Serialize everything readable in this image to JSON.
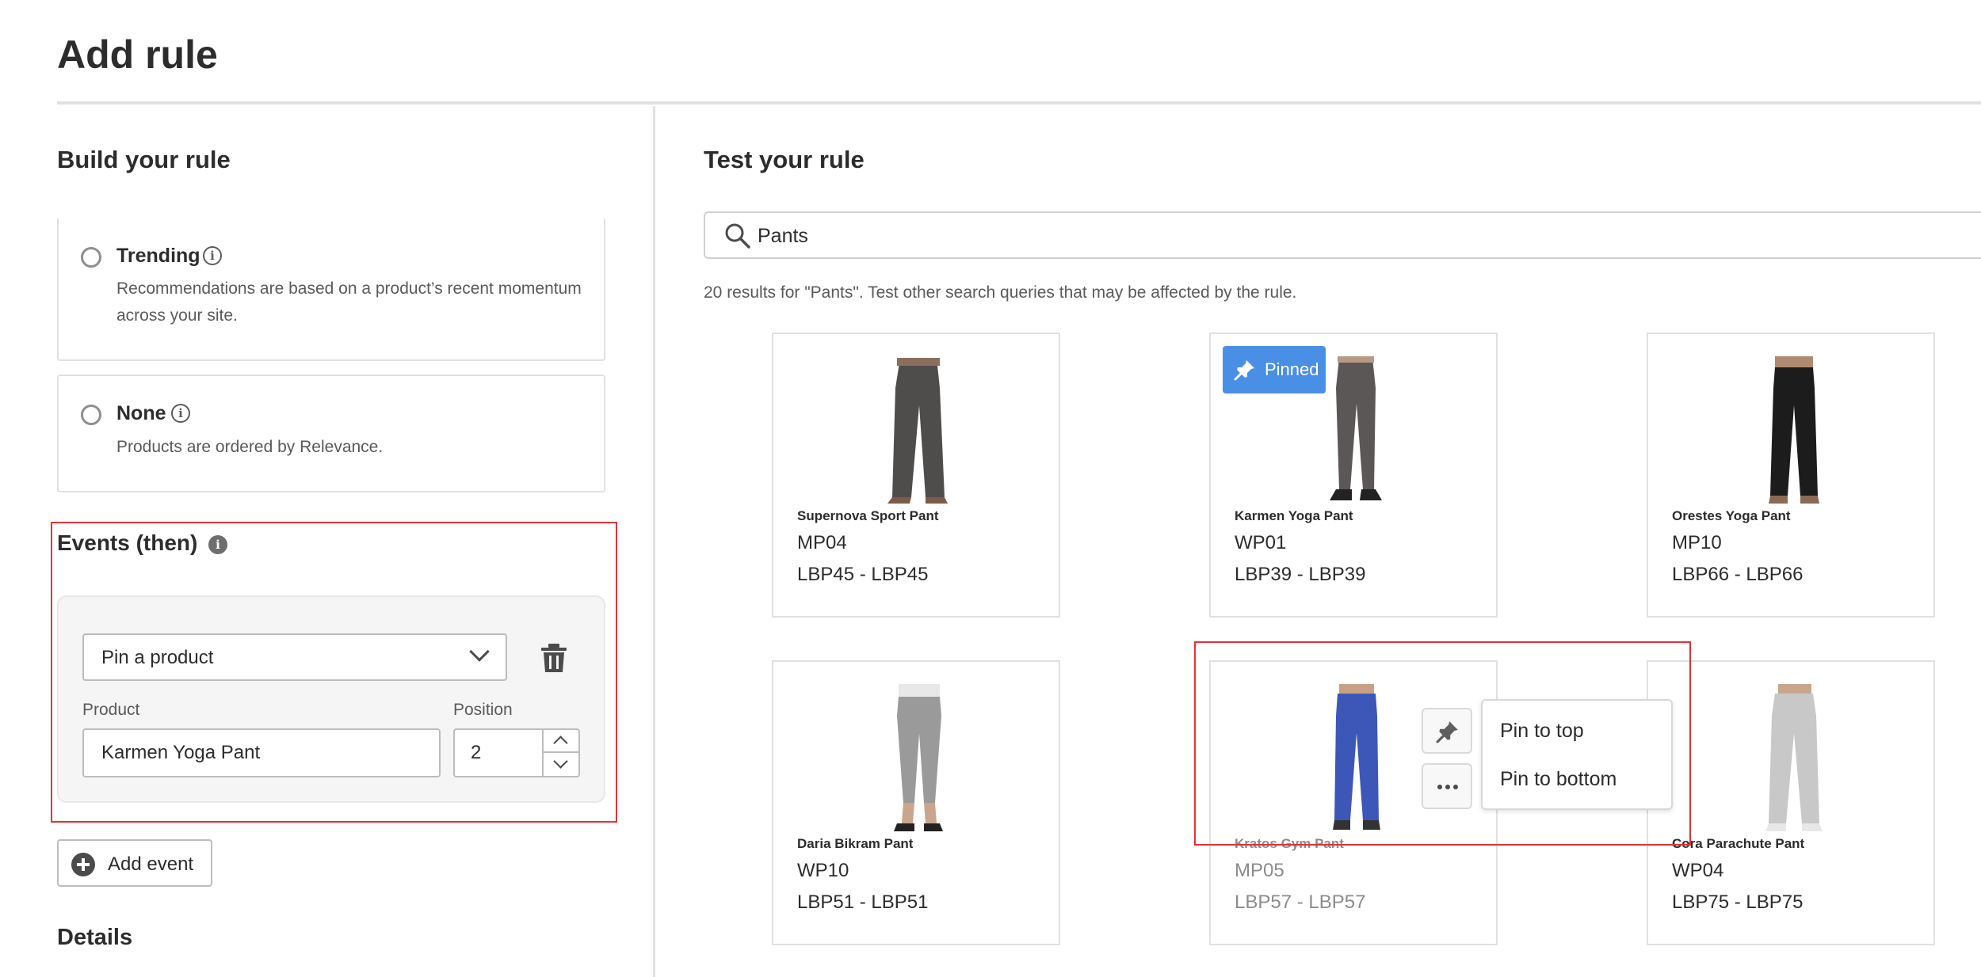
{
  "page": {
    "title": "Add rule"
  },
  "build": {
    "heading": "Build your rule",
    "options": [
      {
        "label": "Trending",
        "description_line1": "Recommendations are based on a product’s recent momentum",
        "description_line2": "across your site."
      },
      {
        "label": "None",
        "description_line1": "Products are ordered by Relevance."
      }
    ],
    "events": {
      "heading": "Events (then)",
      "action_value": "Pin a product",
      "product_label": "Product",
      "product_value": "Karmen Yoga Pant",
      "position_label": "Position",
      "position_value": "2"
    },
    "add_event_label": "Add event",
    "details_heading": "Details"
  },
  "test": {
    "heading": "Test your rule",
    "search_value": "Pants",
    "results_note": "20 results for \"Pants\". Test other search queries that may be affected by the rule.",
    "pinned_label": "Pinned",
    "products": [
      {
        "name": "Supernova Sport Pant",
        "sku": "MP04",
        "price": "LBP45 - LBP45"
      },
      {
        "name": "Karmen Yoga Pant",
        "sku": "WP01",
        "price": "LBP39 - LBP39"
      },
      {
        "name": "Orestes Yoga Pant",
        "sku": "MP10",
        "price": "LBP66 - LBP66"
      },
      {
        "name": "Daria Bikram Pant",
        "sku": "WP10",
        "price": "LBP51 - LBP51"
      },
      {
        "name": "Kratos Gym Pant",
        "sku": "MP05",
        "price": "LBP57 - LBP57"
      },
      {
        "name": "Cora Parachute Pant",
        "sku": "WP04",
        "price": "LBP75 - LBP75"
      }
    ],
    "menu": {
      "pin_top": "Pin to top",
      "pin_bottom": "Pin to bottom"
    }
  },
  "colors": {
    "accent": "#4a8fe6",
    "highlight": "#e0333a",
    "border": "#e1e1e1"
  },
  "icons": [
    "info-icon",
    "chevron-down-icon",
    "trash-icon",
    "plus-circle-icon",
    "search-icon",
    "pin-icon",
    "more-icon"
  ]
}
